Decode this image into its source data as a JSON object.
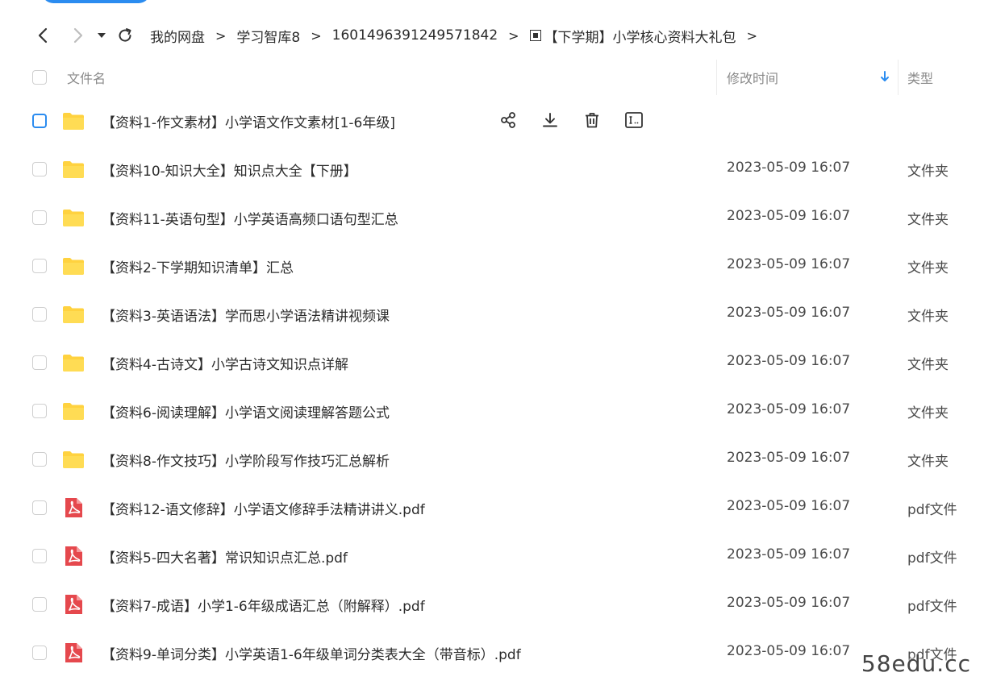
{
  "nav": {
    "breadcrumb": [
      "我的网盘",
      "学习智库8",
      "1601496391249571842",
      "【下学期】小学核心资料大礼包"
    ],
    "separator": ">"
  },
  "header": {
    "name_label": "文件名",
    "time_label": "修改时间",
    "type_label": "类型"
  },
  "files": [
    {
      "name": "【资料1-作文素材】小学语文作文素材[1-6年级]",
      "time": "",
      "type": "",
      "kind": "folder-icon",
      "hovered": true
    },
    {
      "name": "【资料10-知识大全】知识点大全【下册】",
      "time": "2023-05-09 16:07",
      "type": "文件夹",
      "kind": "folder-icon"
    },
    {
      "name": "【资料11-英语句型】小学英语高频口语句型汇总",
      "time": "2023-05-09 16:07",
      "type": "文件夹",
      "kind": "folder-icon"
    },
    {
      "name": "【资料2-下学期知识清单】汇总",
      "time": "2023-05-09 16:07",
      "type": "文件夹",
      "kind": "folder-icon"
    },
    {
      "name": "【资料3-英语语法】学而思小学语法精讲视频课",
      "time": "2023-05-09 16:07",
      "type": "文件夹",
      "kind": "folder-icon"
    },
    {
      "name": "【资料4-古诗文】小学古诗文知识点详解",
      "time": "2023-05-09 16:07",
      "type": "文件夹",
      "kind": "folder-icon"
    },
    {
      "name": "【资料6-阅读理解】小学语文阅读理解答题公式",
      "time": "2023-05-09 16:07",
      "type": "文件夹",
      "kind": "folder-icon"
    },
    {
      "name": "【资料8-作文技巧】小学阶段写作技巧汇总解析",
      "time": "2023-05-09 16:07",
      "type": "文件夹",
      "kind": "folder-icon"
    },
    {
      "name": "【资料12-语文修辞】小学语文修辞手法精讲讲义.pdf",
      "time": "2023-05-09 16:07",
      "type": "pdf文件",
      "kind": "pdf-icon"
    },
    {
      "name": "【资料5-四大名著】常识知识点汇总.pdf",
      "time": "2023-05-09 16:07",
      "type": "pdf文件",
      "kind": "pdf-icon"
    },
    {
      "name": "【资料7-成语】小学1-6年级成语汇总（附解释）.pdf",
      "time": "2023-05-09 16:07",
      "type": "pdf文件",
      "kind": "pdf-icon"
    },
    {
      "name": "【资料9-单词分类】小学英语1-6年级单词分类表大全（带音标）.pdf",
      "time": "2023-05-09 16:07",
      "type": "pdf文件",
      "kind": "pdf-icon"
    }
  ],
  "watermark": "58edu.cc",
  "colors": {
    "accent": "#2b8cf0",
    "folder": "#ffd23f",
    "pdf": "#e5484d"
  }
}
